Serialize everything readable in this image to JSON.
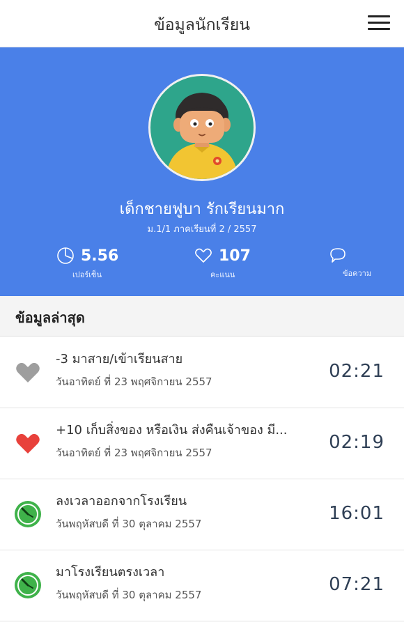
{
  "header": {
    "title": "ข้อมูลนักเรียน",
    "menu_icon": "hamburger-menu-icon"
  },
  "profile": {
    "name": "เด็กชายฟูบา รักเรียนมาก",
    "class_term": "ม.1/1 ภาคเรียนที่ 2 / 2557",
    "accent_color": "#4a80e8",
    "stats": {
      "percent": {
        "value": "5.56",
        "label": "เปอร์เซ็น",
        "icon": "pie-chart-icon"
      },
      "score": {
        "value": "107",
        "label": "คะแนน",
        "icon": "heart-outline-icon"
      },
      "messages": {
        "label": "ข้อความ",
        "icon": "chat-bubble-icon"
      }
    }
  },
  "latest": {
    "title": "ข้อมูลล่าสุด",
    "items": [
      {
        "icon": "heart-gray-icon",
        "icon_color": "#9e9e9e",
        "text": "-3 มาสาย/เข้าเรียนสาย",
        "date": "วันอาทิตย์ ที่ 23 พฤศจิกายน 2557",
        "time": "02:21"
      },
      {
        "icon": "heart-red-icon",
        "icon_color": "#e8413b",
        "text": "+10 เก็บสิ่งของ หรือเงิน ส่งคืนเจ้าของ มี...",
        "date": "วันอาทิตย์ ที่ 23 พฤศจิกายน 2557",
        "time": "02:19"
      },
      {
        "icon": "clock-green-icon",
        "icon_color": "#3fb24a",
        "text": "ลงเวลาออกจากโรงเรียน",
        "date": "วันพฤหัสบดี ที่ 30 ตุลาคม 2557",
        "time": "16:01"
      },
      {
        "icon": "clock-green-icon",
        "icon_color": "#3fb24a",
        "text": "มาโรงเรียนตรงเวลา",
        "date": "วันพฤหัสบดี ที่ 30 ตุลาคม 2557",
        "time": "07:21"
      }
    ]
  }
}
